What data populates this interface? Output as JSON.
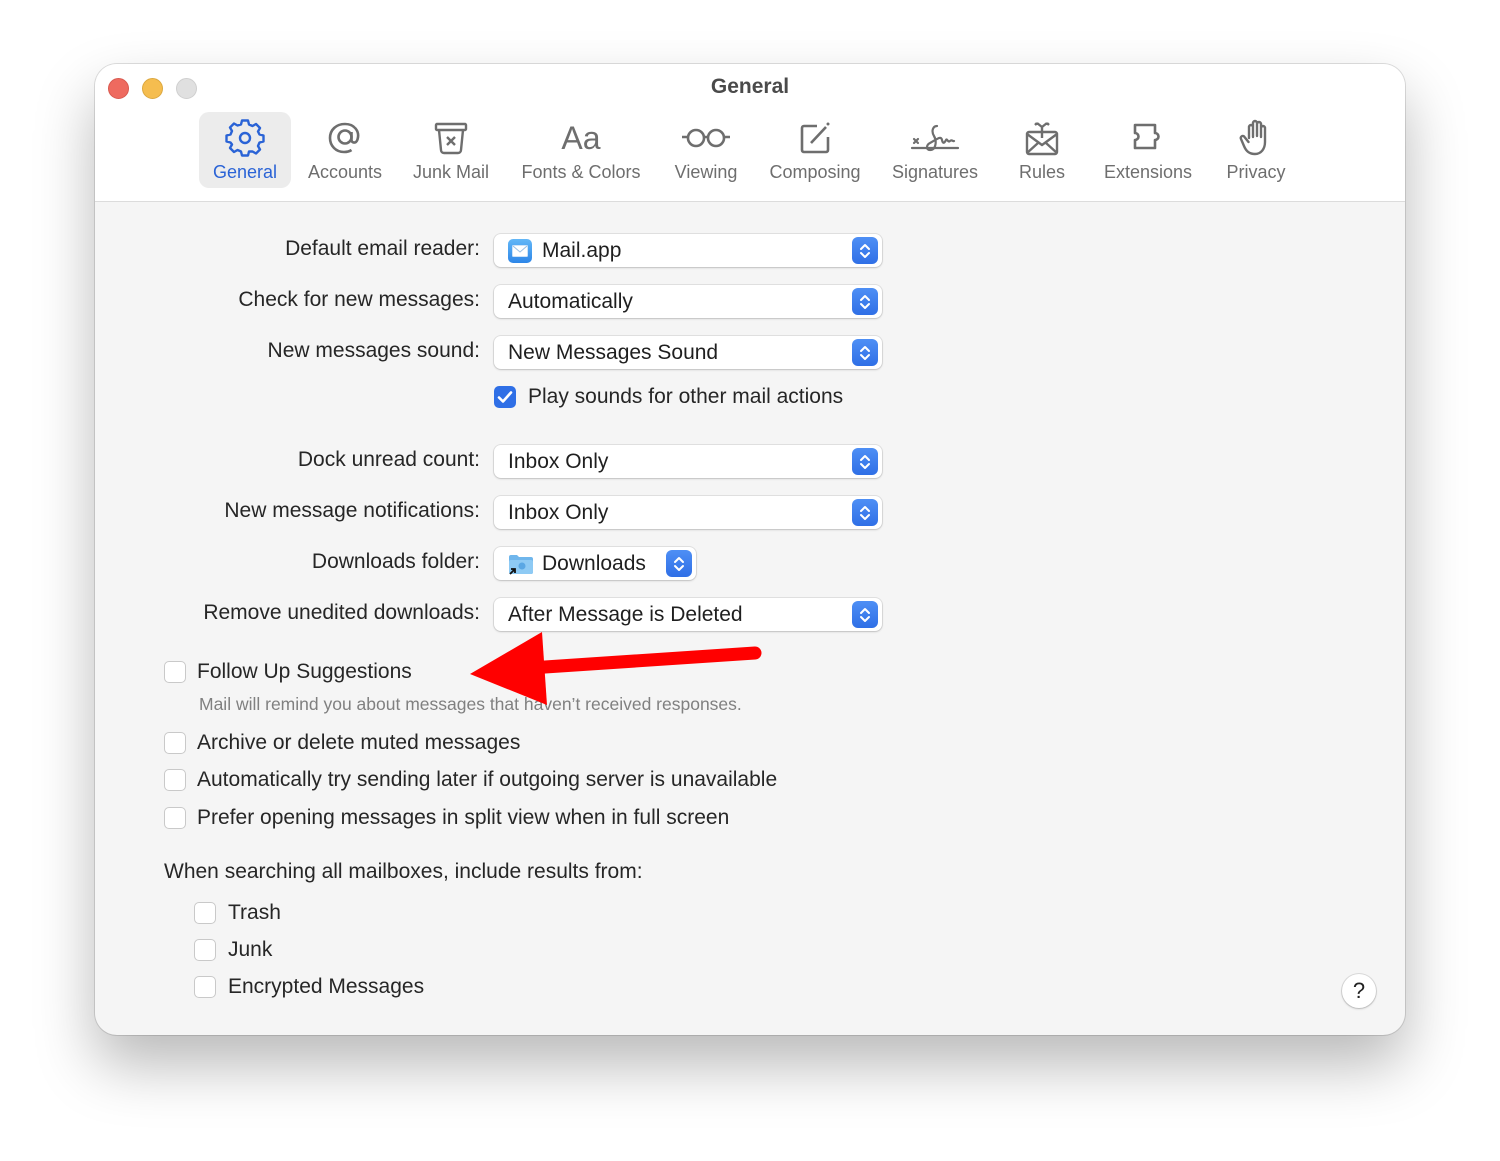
{
  "window": {
    "title": "General",
    "traffic_lights": [
      "close",
      "minimize",
      "zoom"
    ]
  },
  "toolbar": {
    "tabs": [
      {
        "label": "General",
        "icon": "gear-icon",
        "active": true
      },
      {
        "label": "Accounts",
        "icon": "at-sign-icon",
        "active": false
      },
      {
        "label": "Junk Mail",
        "icon": "junk-bin-icon",
        "active": false
      },
      {
        "label": "Fonts & Colors",
        "icon": "fonts-icon",
        "active": false
      },
      {
        "label": "Viewing",
        "icon": "glasses-icon",
        "active": false
      },
      {
        "label": "Composing",
        "icon": "compose-icon",
        "active": false
      },
      {
        "label": "Signatures",
        "icon": "signature-icon",
        "active": false
      },
      {
        "label": "Rules",
        "icon": "rules-envelope-icon",
        "active": false
      },
      {
        "label": "Extensions",
        "icon": "puzzle-icon",
        "active": false
      },
      {
        "label": "Privacy",
        "icon": "hand-icon",
        "active": false
      }
    ],
    "fonts_glyph": "Aa"
  },
  "settings": {
    "default_email_reader": {
      "label": "Default email reader:",
      "value": "Mail.app"
    },
    "check_new_messages": {
      "label": "Check for new messages:",
      "value": "Automatically"
    },
    "new_messages_sound": {
      "label": "New messages sound:",
      "value": "New Messages Sound"
    },
    "play_sounds": {
      "label": "Play sounds for other mail actions",
      "checked": true
    },
    "dock_unread_count": {
      "label": "Dock unread count:",
      "value": "Inbox Only"
    },
    "new_message_notifications": {
      "label": "New message notifications:",
      "value": "Inbox Only"
    },
    "downloads_folder": {
      "label": "Downloads folder:",
      "value": "Downloads"
    },
    "remove_unedited_downloads": {
      "label": "Remove unedited downloads:",
      "value": "After Message is Deleted"
    }
  },
  "options": {
    "follow_up": {
      "label": "Follow Up Suggestions",
      "checked": false,
      "hint": "Mail will remind you about messages that haven’t received responses."
    },
    "archive_muted": {
      "label": "Archive or delete muted messages",
      "checked": false
    },
    "send_later": {
      "label": "Automatically try sending later if outgoing server is unavailable",
      "checked": false
    },
    "split_view": {
      "label": "Prefer opening messages in split view when in full screen",
      "checked": false
    }
  },
  "search": {
    "heading": "When searching all mailboxes, include results from:",
    "items": [
      {
        "label": "Trash",
        "checked": false
      },
      {
        "label": "Junk",
        "checked": false
      },
      {
        "label": "Encrypted Messages",
        "checked": false
      }
    ]
  },
  "help": {
    "label": "?"
  },
  "annotation": {
    "type": "arrow",
    "color": "#ff0000",
    "points_to": "Follow Up Suggestions"
  },
  "colors": {
    "accent": "#2f6fe6",
    "active_tab_text": "#2a63d6",
    "window_bg": "#f5f5f5"
  }
}
